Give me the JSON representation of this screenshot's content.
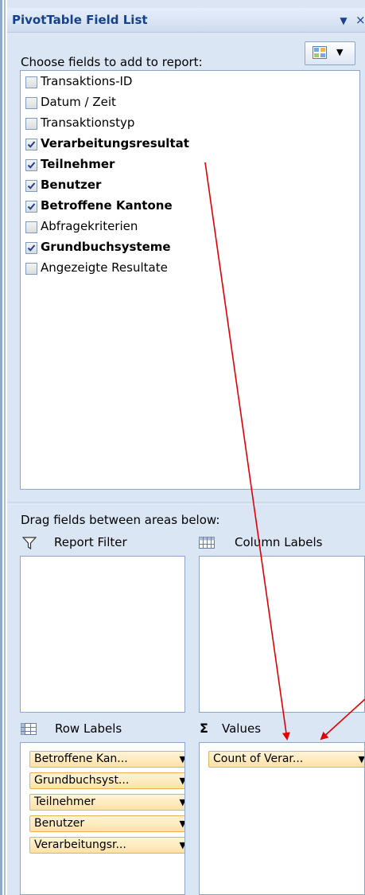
{
  "pane": {
    "title": "PivotTable Field List",
    "dropdown_glyph": "▼",
    "close_glyph": "×",
    "choose_label": "Choose fields to add to report:",
    "layout_button": {
      "icon": "field-layout-icon",
      "dropdown_glyph": "▼"
    }
  },
  "fields": [
    {
      "label": "Transaktions-ID",
      "checked": false
    },
    {
      "label": "Datum / Zeit",
      "checked": false
    },
    {
      "label": "Transaktionstyp",
      "checked": false
    },
    {
      "label": "Verarbeitungsresultat",
      "checked": true
    },
    {
      "label": "Teilnehmer",
      "checked": true
    },
    {
      "label": "Benutzer",
      "checked": true
    },
    {
      "label": "Betroffene Kantone",
      "checked": true
    },
    {
      "label": "Abfragekriterien",
      "checked": false
    },
    {
      "label": "Grundbuchsysteme",
      "checked": true
    },
    {
      "label": "Angezeigte Resultate",
      "checked": false
    }
  ],
  "areas": {
    "drag_hint": "Drag fields between areas below:",
    "report_filter": {
      "label": "Report Filter",
      "icon": "filter-icon"
    },
    "column_labels": {
      "label": "Column Labels",
      "icon": "column-grid-icon"
    },
    "row_labels": {
      "label": "Row Labels",
      "icon": "row-grid-icon",
      "items": [
        "Betroffene Kan...",
        "Grundbuchsyst...",
        "Teilnehmer",
        "Benutzer",
        "Verarbeitungsr..."
      ]
    },
    "values": {
      "label": "Values",
      "icon_glyph": "Σ",
      "items": [
        "Count of Verar..."
      ]
    }
  },
  "chip_dropdown_glyph": "▼",
  "colors": {
    "pane_bg": "#dbe6f5",
    "title_text": "#15428b",
    "chip_fill": "#fde2a7",
    "chip_border": "#e3b358",
    "annotation_arrow": "#e00000"
  }
}
